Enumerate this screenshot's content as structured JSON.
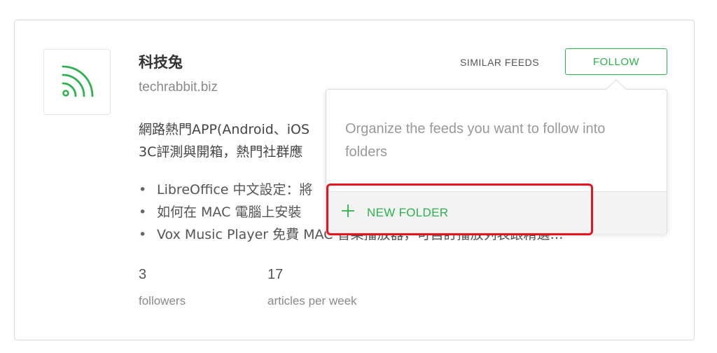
{
  "feed": {
    "title": "科技兔",
    "url": "techrabbit.biz",
    "description_line1": "網路熱門APP(Android、iOS",
    "description_line2": "3C評測與開箱，熱門社群應",
    "icon": "rss-feed-icon",
    "articles": [
      "LibreOffice 中文設定：將",
      "如何在 MAC 電腦上安裝",
      "Vox Music Player 免費 MAC 音樂播放器，可自訂播放列表跟精選…"
    ],
    "stats": {
      "followers_count": "3",
      "followers_label": "followers",
      "articles_count": "17",
      "articles_label": "articles per week"
    }
  },
  "actions": {
    "similar_feeds_label": "SIMILAR FEEDS",
    "follow_label": "FOLLOW"
  },
  "popover": {
    "message": "Organize the feeds you want to follow into folders",
    "new_folder_label": "NEW FOLDER",
    "new_folder_icon": "plus-icon"
  },
  "colors": {
    "accent_green": "#2bb24c",
    "highlight_red": "#e8141d"
  }
}
